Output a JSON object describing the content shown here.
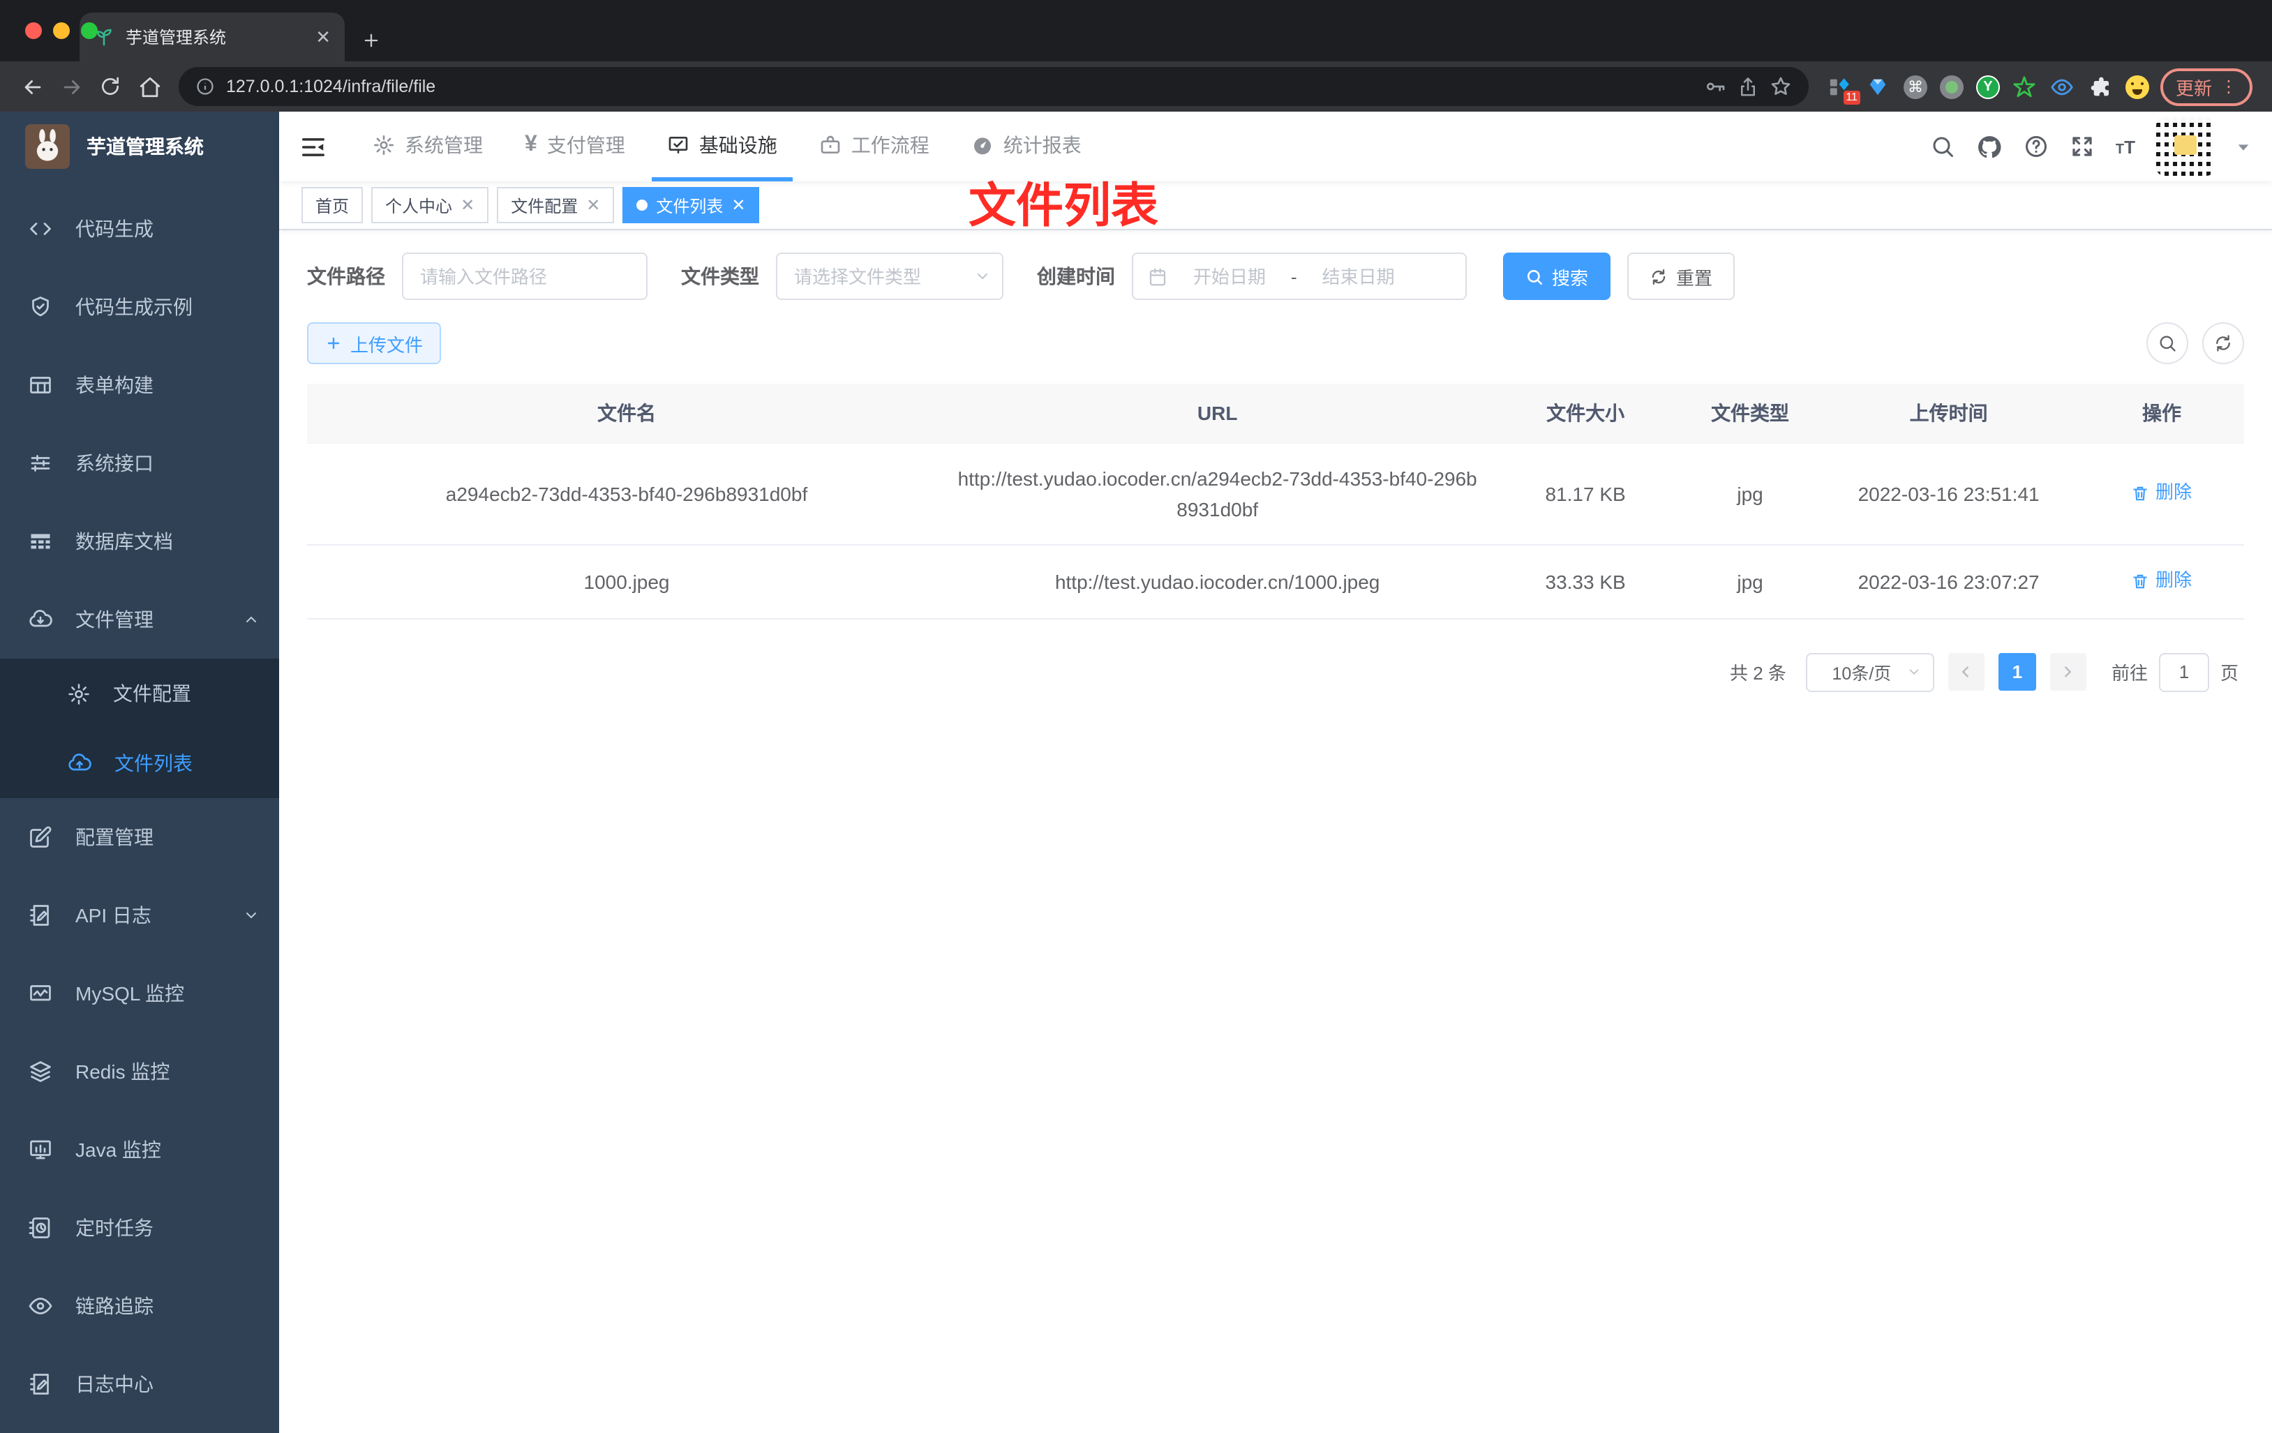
{
  "browser": {
    "tab_title": "芋道管理系统",
    "url": "127.0.0.1:1024/infra/file/file",
    "update_label": "更新",
    "extension_badge": "11"
  },
  "topnav": {
    "menus": [
      "系统管理",
      "支付管理",
      "基础设施",
      "工作流程",
      "统计报表"
    ],
    "active": "基础设施"
  },
  "sidebar": {
    "title": "芋道管理系统",
    "items_top": [
      "代码生成",
      "代码生成示例",
      "表单构建",
      "系统接口",
      "数据库文档"
    ],
    "file_group": "文件管理",
    "file_children": [
      "文件配置",
      "文件列表"
    ],
    "active_item": "文件列表",
    "items_bottom": [
      "配置管理",
      "API 日志",
      "MySQL 监控",
      "Redis 监控",
      "Java 监控",
      "定时任务",
      "链路追踪",
      "日志中心"
    ]
  },
  "tags": [
    "首页",
    "个人中心",
    "文件配置",
    "文件列表"
  ],
  "active_tag": "文件列表",
  "annotation": "文件列表",
  "filters": {
    "path_label": "文件路径",
    "path_placeholder": "请输入文件路径",
    "type_label": "文件类型",
    "type_placeholder": "请选择文件类型",
    "time_label": "创建时间",
    "start_placeholder": "开始日期",
    "range_separator": "-",
    "end_placeholder": "结束日期",
    "search_label": "搜索",
    "reset_label": "重置"
  },
  "toolbar": {
    "upload_label": "上传文件"
  },
  "table": {
    "headers": [
      "文件名",
      "URL",
      "文件大小",
      "文件类型",
      "上传时间",
      "操作"
    ],
    "rows": [
      {
        "name": "a294ecb2-73dd-4353-bf40-296b8931d0bf",
        "url": "http://test.yudao.iocoder.cn/a294ecb2-73dd-4353-bf40-296b8931d0bf",
        "size": "81.17 KB",
        "type": "jpg",
        "time": "2022-03-16 23:51:41",
        "action": "删除"
      },
      {
        "name": "1000.jpeg",
        "url": "http://test.yudao.iocoder.cn/1000.jpeg",
        "size": "33.33 KB",
        "type": "jpg",
        "time": "2022-03-16 23:07:27",
        "action": "删除"
      }
    ]
  },
  "pagination": {
    "total": "共 2 条",
    "page_size": "10条/页",
    "current_page": "1",
    "goto_label": "前往",
    "goto_value": "1",
    "page_unit": "页"
  },
  "colors": {
    "accent": "#409eff",
    "sidebar_bg": "#304156",
    "submenu_bg": "#1f2d3d",
    "annotation_red": "#fe2c25"
  }
}
